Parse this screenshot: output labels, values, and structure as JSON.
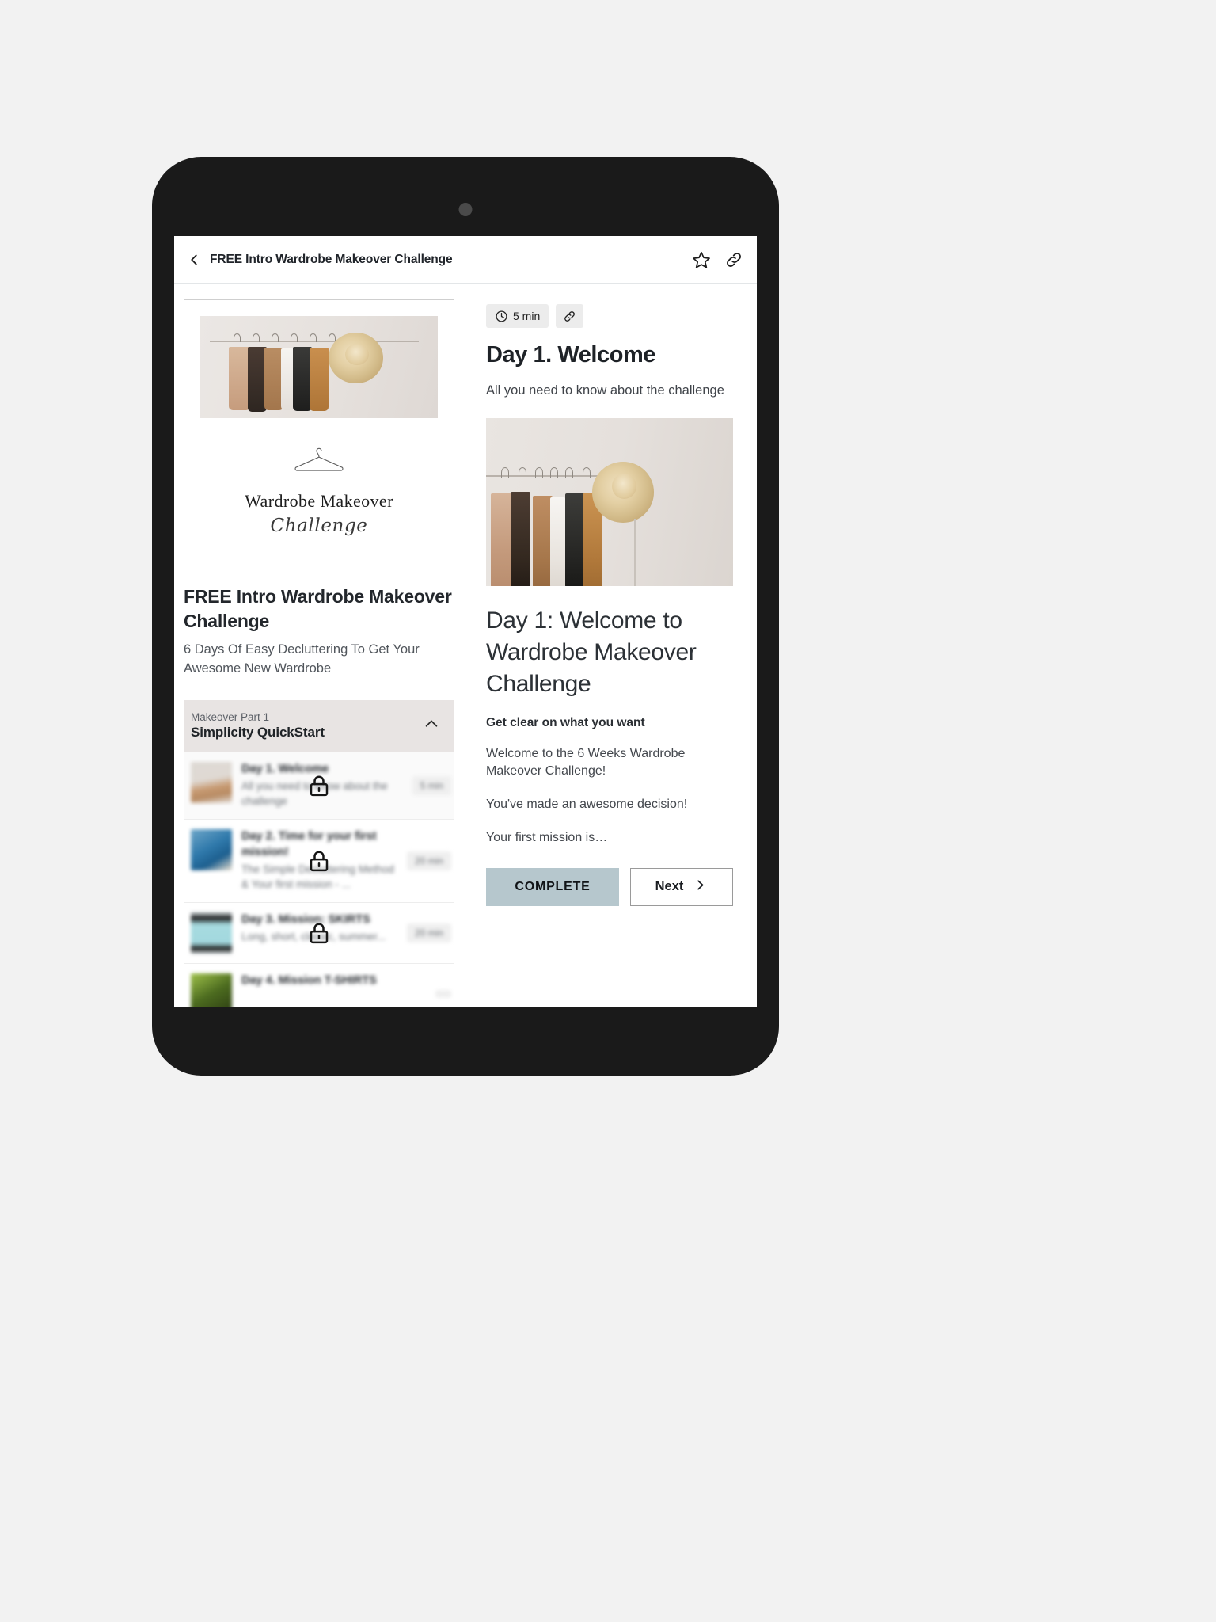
{
  "app": {
    "header": {
      "back_icon": "back-chevron-icon",
      "title": "FREE Intro Wardrobe Makeover Challenge",
      "favorite_icon": "star-icon",
      "share_icon": "link-icon"
    }
  },
  "sidebar": {
    "cover": {
      "brand_line1": "Wardrobe Makeover",
      "brand_line2": "Challenge",
      "hanger_icon": "hanger-icon"
    },
    "course_title": "FREE Intro Wardrobe Makeover Challenge",
    "course_subtitle": "6 Days Of Easy Decluttering To Get Your Awesome New Wardrobe",
    "section": {
      "eyebrow": "Makeover Part 1",
      "name": "Simplicity QuickStart",
      "collapse_icon": "chevron-up-icon",
      "expanded": true
    },
    "lessons": [
      {
        "title": "Day 1. Welcome",
        "description": "All you need to know about the challenge",
        "duration": "5 min",
        "locked": true,
        "lock_icon": "lock-icon",
        "active": true
      },
      {
        "title": "Day 2. Time for your first mission!",
        "description": "The Simple Decluttering Method & Your first mission - ...",
        "duration": "20 min",
        "locked": true,
        "lock_icon": "lock-icon",
        "active": false
      },
      {
        "title": "Day 3. Mission: SKIRTS",
        "description": "Long, short, classic, summer...",
        "duration": "20 min",
        "locked": true,
        "lock_icon": "lock-icon",
        "active": false
      },
      {
        "title": "Day 4. Mission T-SHIRTS",
        "description": "",
        "duration": "",
        "locked": true,
        "lock_icon": "lock-icon",
        "active": false
      }
    ]
  },
  "lesson": {
    "duration_badge": "5 min",
    "clock_icon": "clock-icon",
    "share_icon": "link-icon",
    "heading": "Day 1. Welcome",
    "subheading": "All you need to know about the challenge",
    "hero_image": "clothing-rack-with-straw-hat-photo",
    "content_heading": "Day 1: Welcome to Wardrobe Makeover Challenge",
    "content_subheading": "Get clear on what you want",
    "paragraphs": [
      "Welcome to the 6 Weeks Wardrobe Makeover Challenge!",
      "You've made an awesome decision!",
      "Your first mission is…"
    ],
    "complete_label": "COMPLETE",
    "next_label": "Next",
    "next_icon": "chevron-right-icon"
  },
  "colors": {
    "page_background": "#f2f2f2",
    "device_bezel": "#1a1a1a",
    "complete_button": "#b6c7cd",
    "section_header": "#e8e4e3",
    "chip_background": "#ececec"
  }
}
